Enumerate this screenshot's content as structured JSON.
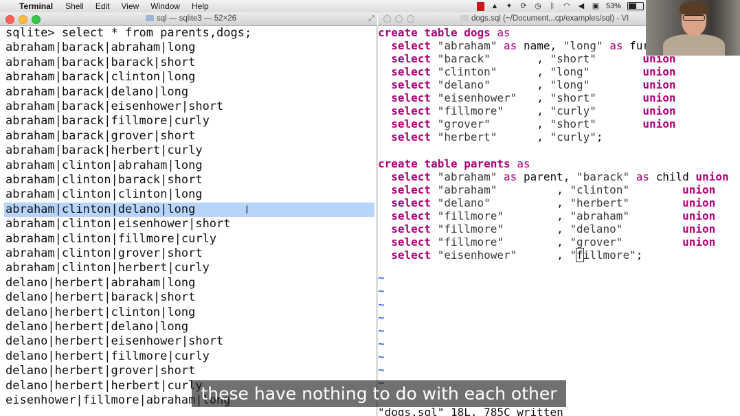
{
  "menubar": {
    "apple_glyph": "",
    "app_name": "Terminal",
    "items": [
      "Shell",
      "Edit",
      "View",
      "Window",
      "Help"
    ],
    "battery_percent": "53%"
  },
  "terminal_window": {
    "title": "sql — sqlite3 — 52×26",
    "lines": [
      "sqlite> select * from parents,dogs;",
      "abraham|barack|abraham|long",
      "abraham|barack|barack|short",
      "abraham|barack|clinton|long",
      "abraham|barack|delano|long",
      "abraham|barack|eisenhower|short",
      "abraham|barack|fillmore|curly",
      "abraham|barack|grover|short",
      "abraham|barack|herbert|curly",
      "abraham|clinton|abraham|long",
      "abraham|clinton|barack|short",
      "abraham|clinton|clinton|long",
      "abraham|clinton|delano|long",
      "abraham|clinton|eisenhower|short",
      "abraham|clinton|fillmore|curly",
      "abraham|clinton|grover|short",
      "abraham|clinton|herbert|curly",
      "delano|herbert|abraham|long",
      "delano|herbert|barack|short",
      "delano|herbert|clinton|long",
      "delano|herbert|delano|long",
      "delano|herbert|eisenhower|short",
      "delano|herbert|fillmore|curly",
      "delano|herbert|grover|short",
      "delano|herbert|herbert|curly",
      "eisenhower|fillmore|abraham|long"
    ],
    "highlighted_line_index": 12
  },
  "vim_window": {
    "title": "dogs.sql (~/Document...cp/examples/sql) - VI",
    "lines": [
      [
        [
          "kw",
          "create table "
        ],
        [
          "kw",
          "dogs"
        ],
        [
          "n",
          " "
        ],
        [
          "kw2",
          "as"
        ]
      ],
      [
        [
          "n",
          "  "
        ],
        [
          "kw",
          "select "
        ],
        [
          "st",
          "\"abraham\""
        ],
        [
          "n",
          " "
        ],
        [
          "kw2",
          "as"
        ],
        [
          "n",
          " name, "
        ],
        [
          "st",
          "\"long\""
        ],
        [
          "n",
          " "
        ],
        [
          "kw2",
          "as"
        ],
        [
          "n",
          " fur"
        ]
      ],
      [
        [
          "n",
          "  "
        ],
        [
          "kw",
          "select "
        ],
        [
          "st",
          "\"barack\""
        ],
        [
          "n",
          "       , "
        ],
        [
          "st",
          "\"short\""
        ],
        [
          "n",
          "       "
        ],
        [
          "kw",
          "union"
        ]
      ],
      [
        [
          "n",
          "  "
        ],
        [
          "kw",
          "select "
        ],
        [
          "st",
          "\"clinton\""
        ],
        [
          "n",
          "      , "
        ],
        [
          "st",
          "\"long\""
        ],
        [
          "n",
          "        "
        ],
        [
          "kw",
          "union"
        ]
      ],
      [
        [
          "n",
          "  "
        ],
        [
          "kw",
          "select "
        ],
        [
          "st",
          "\"delano\""
        ],
        [
          "n",
          "       , "
        ],
        [
          "st",
          "\"long\""
        ],
        [
          "n",
          "        "
        ],
        [
          "kw",
          "union"
        ]
      ],
      [
        [
          "n",
          "  "
        ],
        [
          "kw",
          "select "
        ],
        [
          "st",
          "\"eisenhower\""
        ],
        [
          "n",
          "   , "
        ],
        [
          "st",
          "\"short\""
        ],
        [
          "n",
          "       "
        ],
        [
          "kw",
          "union"
        ]
      ],
      [
        [
          "n",
          "  "
        ],
        [
          "kw",
          "select "
        ],
        [
          "st",
          "\"fillmore\""
        ],
        [
          "n",
          "     , "
        ],
        [
          "st",
          "\"curly\""
        ],
        [
          "n",
          "       "
        ],
        [
          "kw",
          "union"
        ]
      ],
      [
        [
          "n",
          "  "
        ],
        [
          "kw",
          "select "
        ],
        [
          "st",
          "\"grover\""
        ],
        [
          "n",
          "       , "
        ],
        [
          "st",
          "\"short\""
        ],
        [
          "n",
          "       "
        ],
        [
          "kw",
          "union"
        ]
      ],
      [
        [
          "n",
          "  "
        ],
        [
          "kw",
          "select "
        ],
        [
          "st",
          "\"herbert\""
        ],
        [
          "n",
          "      , "
        ],
        [
          "st",
          "\"curly\""
        ],
        [
          "n",
          ";"
        ]
      ],
      [
        [
          "n",
          ""
        ]
      ],
      [
        [
          "kw",
          "create table "
        ],
        [
          "kw",
          "parents"
        ],
        [
          "n",
          " "
        ],
        [
          "kw2",
          "as"
        ]
      ],
      [
        [
          "n",
          "  "
        ],
        [
          "kw",
          "select "
        ],
        [
          "st",
          "\"abraham\""
        ],
        [
          "n",
          " "
        ],
        [
          "kw2",
          "as"
        ],
        [
          "n",
          " parent, "
        ],
        [
          "st",
          "\"barack\""
        ],
        [
          "n",
          " "
        ],
        [
          "kw2",
          "as"
        ],
        [
          "n",
          " child "
        ],
        [
          "kw",
          "union"
        ]
      ],
      [
        [
          "n",
          "  "
        ],
        [
          "kw",
          "select "
        ],
        [
          "st",
          "\"abraham\""
        ],
        [
          "n",
          "         , "
        ],
        [
          "st",
          "\"clinton\""
        ],
        [
          "n",
          "        "
        ],
        [
          "kw",
          "union"
        ]
      ],
      [
        [
          "n",
          "  "
        ],
        [
          "kw",
          "select "
        ],
        [
          "st",
          "\"delano\""
        ],
        [
          "n",
          "          , "
        ],
        [
          "st",
          "\"herbert\""
        ],
        [
          "n",
          "        "
        ],
        [
          "kw",
          "union"
        ]
      ],
      [
        [
          "n",
          "  "
        ],
        [
          "kw",
          "select "
        ],
        [
          "st",
          "\"fillmore\""
        ],
        [
          "n",
          "        , "
        ],
        [
          "st",
          "\"abraham\""
        ],
        [
          "n",
          "        "
        ],
        [
          "kw",
          "union"
        ]
      ],
      [
        [
          "n",
          "  "
        ],
        [
          "kw",
          "select "
        ],
        [
          "st",
          "\"fillmore\""
        ],
        [
          "n",
          "        , "
        ],
        [
          "st",
          "\"delano\""
        ],
        [
          "n",
          "         "
        ],
        [
          "kw",
          "union"
        ]
      ],
      [
        [
          "n",
          "  "
        ],
        [
          "kw",
          "select "
        ],
        [
          "st",
          "\"fillmore\""
        ],
        [
          "n",
          "        , "
        ],
        [
          "st",
          "\"grover\""
        ],
        [
          "n",
          "         "
        ],
        [
          "kw",
          "union"
        ]
      ],
      [
        [
          "n",
          "  "
        ],
        [
          "kw",
          "select "
        ],
        [
          "st",
          "\"eisenhower\""
        ],
        [
          "n",
          "      , "
        ],
        [
          "st",
          "\""
        ],
        [
          "cur",
          "f"
        ],
        [
          "st",
          "illmore\""
        ],
        [
          "n",
          ";"
        ]
      ]
    ],
    "tilde_count": 9,
    "status_line": "\"dogs.sql\" 18L, 785C written"
  },
  "caption": "these have nothing to do with each other",
  "colors": {
    "keyword": "#b1007a",
    "tilde": "#3d6fd6",
    "selection": "#b7d5fb"
  }
}
